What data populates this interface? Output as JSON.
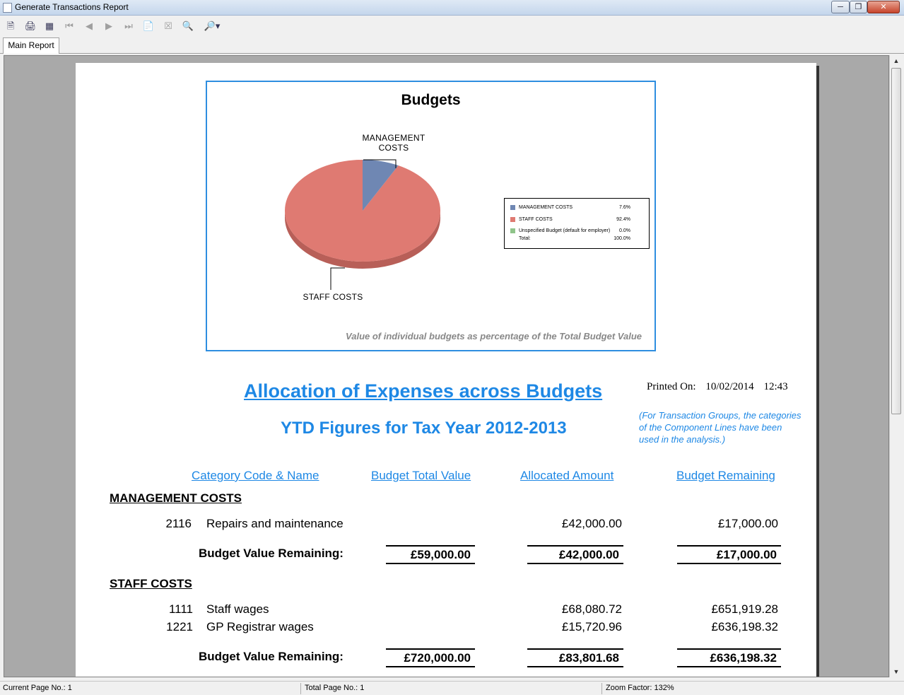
{
  "window": {
    "title": "Generate Transactions Report"
  },
  "toolbar": {
    "icons": [
      "export-icon",
      "print-icon",
      "group-tree-icon",
      "first-page-icon",
      "prev-page-icon",
      "next-page-icon",
      "last-page-icon",
      "goto-page-icon",
      "stop-icon",
      "search-icon",
      "zoom-icon"
    ]
  },
  "tabs": {
    "main": "Main Report"
  },
  "status": {
    "current_page": "Current Page No.: 1",
    "total_page": "Total Page No.: 1",
    "zoom": "Zoom Factor: 132%"
  },
  "chart_data": {
    "type": "pie",
    "title": "Budgets",
    "caption": "Value of individual budgets as percentage of the Total Budget Value",
    "slice_labels": {
      "management": "MANAGEMENT\nCOSTS",
      "staff": "STAFF COSTS"
    },
    "series": [
      {
        "name": "MANAGEMENT COSTS",
        "value": 7.6,
        "display": "7.6%",
        "color": "#6f87b3"
      },
      {
        "name": "STAFF COSTS",
        "value": 92.4,
        "display": "92.4%",
        "color": "#df7a72"
      },
      {
        "name": "Unspecified Budget (default for employer)",
        "value": 0.0,
        "display": "0.0%",
        "color": "#8fc48a"
      }
    ],
    "total_label": "Total:",
    "total_display": "100.0%"
  },
  "report": {
    "title": "Allocation of Expenses across Budgets",
    "printed_label": "Printed On:",
    "printed_date": "10/02/2014",
    "printed_time": "12:43",
    "subtitle": "YTD Figures for Tax Year  2012-2013",
    "note": "(For Transaction Groups, the categories of the Component Lines have been used in the analysis.)",
    "columns": {
      "category": "Category Code & Name",
      "budget_total": "Budget Total Value",
      "allocated": "Allocated Amount",
      "remaining": "Budget Remaining"
    },
    "sections": [
      {
        "name": "MANAGEMENT COSTS",
        "rows": [
          {
            "code": "2116",
            "name": "Repairs and maintenance",
            "allocated": "£42,000.00",
            "remaining": "£17,000.00"
          }
        ],
        "total_label": "Budget Value Remaining:",
        "total_budget": "£59,000.00",
        "total_allocated": "£42,000.00",
        "total_remaining": "£17,000.00"
      },
      {
        "name": "STAFF COSTS",
        "rows": [
          {
            "code": "1111",
            "name": "Staff wages",
            "allocated": "£68,080.72",
            "remaining": "£651,919.28"
          },
          {
            "code": "1221",
            "name": "GP Registrar wages",
            "allocated": "£15,720.96",
            "remaining": "£636,198.32"
          }
        ],
        "total_label": "Budget Value Remaining:",
        "total_budget": "£720,000.00",
        "total_allocated": "£83,801.68",
        "total_remaining": "£636,198.32"
      }
    ]
  }
}
